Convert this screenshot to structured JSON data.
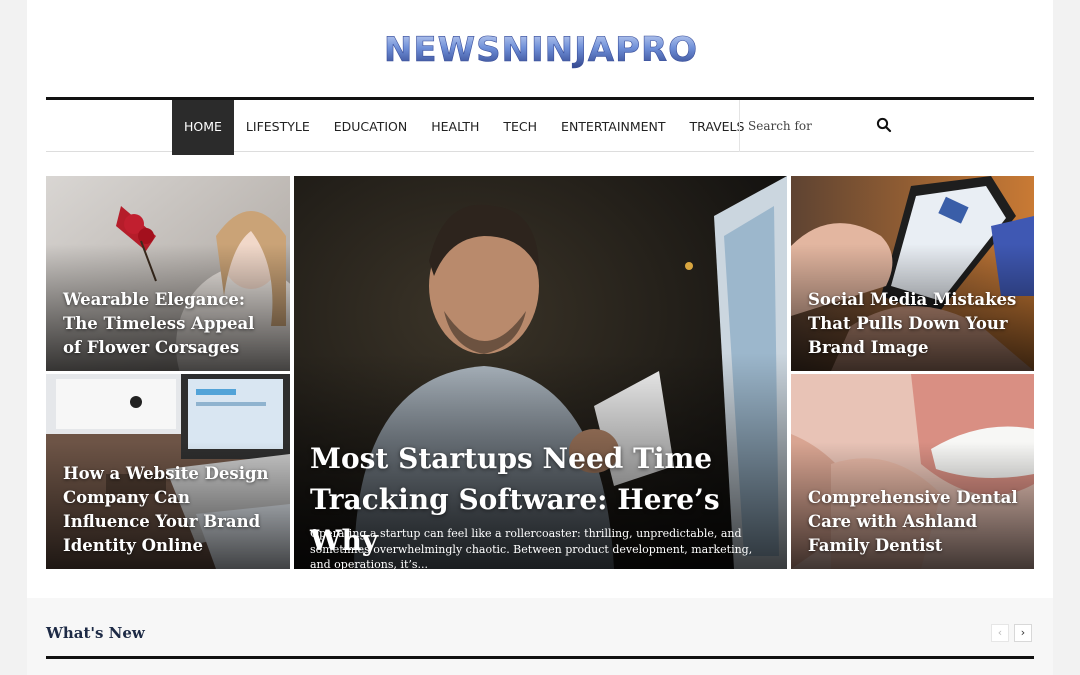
{
  "site": {
    "logo_text": "NEWSNINJAPRO"
  },
  "nav": {
    "items": [
      {
        "label": "HOME",
        "active": true
      },
      {
        "label": "LIFESTYLE"
      },
      {
        "label": "EDUCATION"
      },
      {
        "label": "HEALTH"
      },
      {
        "label": "TECH"
      },
      {
        "label": "ENTERTAINMENT"
      },
      {
        "label": "TRAVELS"
      }
    ],
    "search_placeholder": "Search for",
    "search_icon": "search-icon"
  },
  "featured": {
    "left_top": {
      "title": "Wearable Elegance: The Timeless Appeal of Flower Corsages"
    },
    "left_bottom": {
      "title": "How a Website Design Company Can Influence Your Brand Identity Online"
    },
    "main": {
      "title": "Most Startups Need Time Tracking Software: Here’s Why",
      "excerpt": "Operating a startup can feel like a rollercoaster: thrilling, unpredictable, and sometimes overwhelmingly chaotic. Between product development, marketing, and operations, it’s..."
    },
    "right_top": {
      "title": "Social Media Mistakes That Pulls Down Your Brand Image"
    },
    "right_bottom": {
      "title": "Comprehensive Dental Care with Ashland Family Dentist"
    }
  },
  "section": {
    "title": "What's New",
    "prev_icon": "chevron-left-icon",
    "next_icon": "chevron-right-icon",
    "prev_label": "‹",
    "next_label": "›"
  },
  "colors": {
    "logo_blue": "#5a7fd6",
    "nav_active_bg": "#2b2b2b",
    "section_title": "#1d2a45"
  }
}
